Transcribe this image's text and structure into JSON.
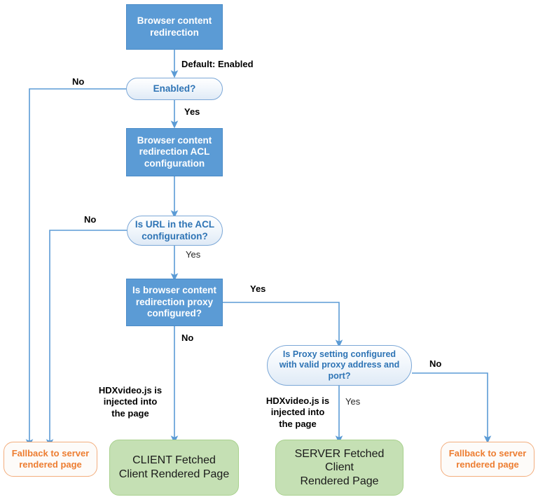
{
  "diagram": {
    "title": "Browser content redirection decision flow",
    "colors": {
      "process_fill": "#5B9BD5",
      "decision_stroke": "#7BA7D7",
      "decision_text": "#2E74B5",
      "terminal_green_fill": "#C5E0B4",
      "terminal_green_stroke": "#A9D18E",
      "fallback_orange_text": "#ED7D31",
      "fallback_orange_stroke": "#F3AE7E",
      "connector": "#5B9BD5",
      "label_text": "#000000"
    },
    "nodes": {
      "start": {
        "label": "Browser content\nredirection",
        "shape": "process"
      },
      "enabled": {
        "label": "Enabled?",
        "shape": "decision"
      },
      "acl_config": {
        "label": "Browser content\nredirection ACL\nconfiguration",
        "shape": "process"
      },
      "url_in_acl": {
        "label": "Is URL in the ACL\nconfiguration?",
        "shape": "decision"
      },
      "proxy_configured": {
        "label": "Is browser content\nredirection proxy\nconfigured?",
        "shape": "process"
      },
      "proxy_valid": {
        "label": "Is Proxy setting configured\nwith valid proxy address and\nport?",
        "shape": "decision"
      },
      "fallback_left": {
        "label": "Fallback to server\nrendered page",
        "shape": "terminal-orange"
      },
      "client_fetched": {
        "label": "CLIENT Fetched\nClient Rendered Page",
        "shape": "terminal-green"
      },
      "server_fetched": {
        "label": "SERVER Fetched Client\nRendered Page",
        "shape": "terminal-green"
      },
      "fallback_right": {
        "label": "Fallback to server\nrendered page",
        "shape": "terminal-orange"
      }
    },
    "edge_labels": {
      "default_enabled": "Default: Enabled",
      "enabled_no": "No",
      "enabled_yes": "Yes",
      "acl_no": "No",
      "acl_yes": "Yes",
      "proxy_yes": "Yes",
      "proxy_no": "No",
      "proxy_valid_no": "No",
      "proxy_valid_yes": "Yes",
      "hdx_inject_left": "HDXvideo.js is\ninjected into\nthe page",
      "hdx_inject_right": "HDXvideo.js is\ninjected into\nthe page"
    }
  }
}
